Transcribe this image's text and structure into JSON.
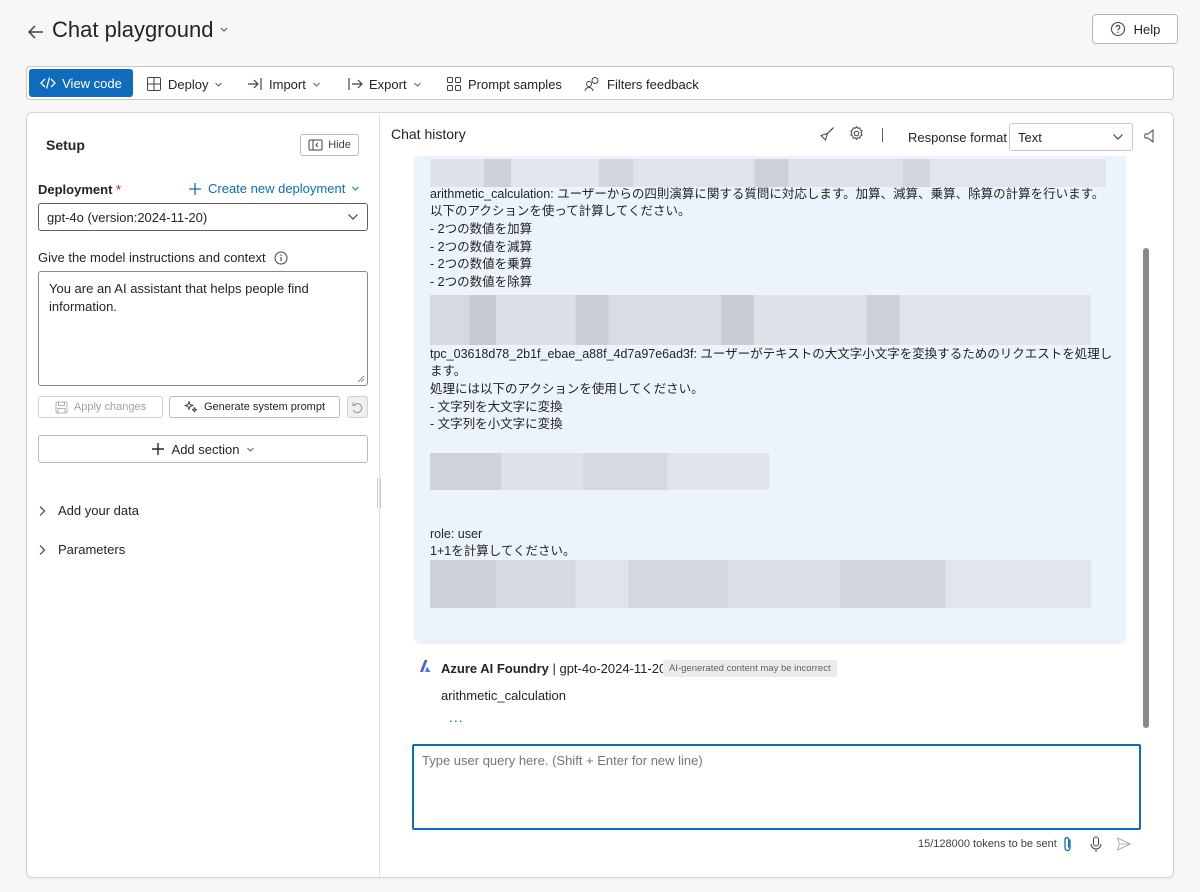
{
  "header": {
    "title": "Chat playground",
    "help_label": "Help"
  },
  "toolbar": {
    "view_code": "View code",
    "deploy": "Deploy",
    "import": "Import",
    "export": "Export",
    "prompt_samples": "Prompt samples",
    "filters_feedback": "Filters feedback"
  },
  "setup": {
    "title": "Setup",
    "hide_label": "Hide",
    "deployment_label": "Deployment",
    "required_mark": "*",
    "create_new_deployment": "Create new deployment",
    "deployment_value": "gpt-4o (version:2024-11-20)",
    "instructions_label": "Give the model instructions and context",
    "instructions_text": "You are an AI assistant that helps people find information.",
    "apply_changes": "Apply changes",
    "generate_system_prompt": "Generate system prompt",
    "add_section": "Add section",
    "add_your_data": "Add your data",
    "parameters": "Parameters"
  },
  "chat": {
    "title": "Chat history",
    "response_format_label": "Response format",
    "response_format_value": "Text",
    "bubble_lines": [
      "arithmetic_calculation: ユーザーからの四則演算に関する質問に対応します。加算、減算、乗算、除算の計算を行います。",
      "以下のアクションを使って計算してください。",
      "- 2つの数値を加算",
      "- 2つの数値を減算",
      "- 2つの数値を乗算",
      "- 2つの数値を除算",
      "tpc_03618d78_2b1f_ebae_a88f_4d7a97e6ad3f: ユーザーがテキストの大文字小文字を変換するためのリクエストを処理し",
      "ます。",
      "処理には以下のアクションを使用してください。",
      "- 文字列を大文字に変換",
      "- 文字列を小文字に変換",
      "role: user",
      "1+1を計算してください。"
    ],
    "bot_name": "Azure AI Foundry",
    "bot_model": "| gpt-4o-2024-11-20",
    "ai_badge": "AI-generated content may be incorrect",
    "bot_message": "arithmetic_calculation",
    "bot_dots": "...",
    "query_placeholder": "Type user query here. (Shift + Enter for new line)",
    "tokens_text": "15/128000 tokens to be sent"
  },
  "colors": {
    "accent": "#0f6cbd",
    "bubble_bg": "#ebf3fc",
    "required": "#c50f1f"
  }
}
